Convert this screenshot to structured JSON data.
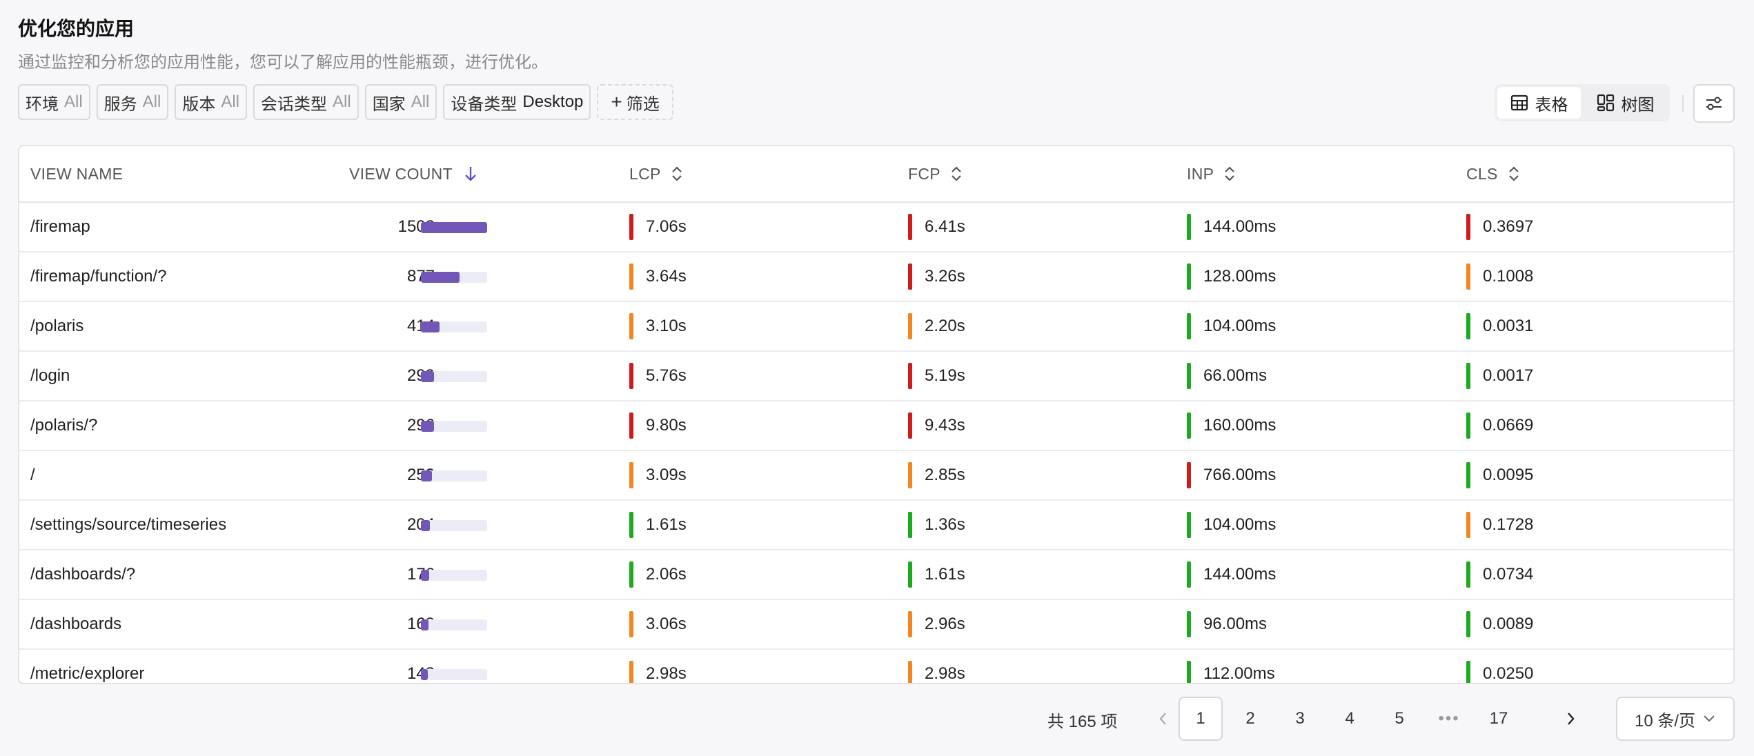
{
  "header": {
    "title": "优化您的应用",
    "subtitle": "通过监控和分析您的应用性能，您可以了解应用的性能瓶颈，进行优化。"
  },
  "filters": [
    {
      "label": "环境",
      "value": "All"
    },
    {
      "label": "服务",
      "value": "All"
    },
    {
      "label": "版本",
      "value": "All"
    },
    {
      "label": "会话类型",
      "value": "All"
    },
    {
      "label": "国家",
      "value": "All"
    },
    {
      "label": "设备类型",
      "value": "Desktop"
    }
  ],
  "add_filter_label": "筛选",
  "view_toggle": {
    "table_label": "表格",
    "tree_label": "树图",
    "active": "table"
  },
  "columns": {
    "view_name": "VIEW NAME",
    "view_count": "VIEW COUNT",
    "lcp": "LCP",
    "fcp": "FCP",
    "inp": "INP",
    "cls": "CLS"
  },
  "colors": {
    "good": "#1aab1f",
    "needs_improvement": "#f5861f",
    "poor": "#cf1b1b",
    "bar": "#7256b8"
  },
  "rows": [
    {
      "name": "/firemap",
      "count": "1502",
      "count_ratio": 1.0,
      "lcp": "7.06s",
      "lcp_s": "poor",
      "fcp": "6.41s",
      "fcp_s": "poor",
      "inp": "144.00ms",
      "inp_s": "good",
      "cls": "0.3697",
      "cls_s": "poor"
    },
    {
      "name": "/firemap/function/?",
      "count": "877",
      "count_ratio": 0.58,
      "lcp": "3.64s",
      "lcp_s": "needs_improvement",
      "fcp": "3.26s",
      "fcp_s": "poor",
      "inp": "128.00ms",
      "inp_s": "good",
      "cls": "0.1008",
      "cls_s": "needs_improvement"
    },
    {
      "name": "/polaris",
      "count": "414",
      "count_ratio": 0.28,
      "lcp": "3.10s",
      "lcp_s": "needs_improvement",
      "fcp": "2.20s",
      "fcp_s": "needs_improvement",
      "inp": "104.00ms",
      "inp_s": "good",
      "cls": "0.0031",
      "cls_s": "good"
    },
    {
      "name": "/login",
      "count": "299",
      "count_ratio": 0.2,
      "lcp": "5.76s",
      "lcp_s": "poor",
      "fcp": "5.19s",
      "fcp_s": "poor",
      "inp": "66.00ms",
      "inp_s": "good",
      "cls": "0.0017",
      "cls_s": "good"
    },
    {
      "name": "/polaris/?",
      "count": "296",
      "count_ratio": 0.2,
      "lcp": "9.80s",
      "lcp_s": "poor",
      "fcp": "9.43s",
      "fcp_s": "poor",
      "inp": "160.00ms",
      "inp_s": "good",
      "cls": "0.0669",
      "cls_s": "good"
    },
    {
      "name": "/",
      "count": "252",
      "count_ratio": 0.17,
      "lcp": "3.09s",
      "lcp_s": "needs_improvement",
      "fcp": "2.85s",
      "fcp_s": "needs_improvement",
      "inp": "766.00ms",
      "inp_s": "poor",
      "cls": "0.0095",
      "cls_s": "good"
    },
    {
      "name": "/settings/source/timeseries",
      "count": "204",
      "count_ratio": 0.14,
      "lcp": "1.61s",
      "lcp_s": "good",
      "fcp": "1.36s",
      "fcp_s": "good",
      "inp": "104.00ms",
      "inp_s": "good",
      "cls": "0.1728",
      "cls_s": "needs_improvement"
    },
    {
      "name": "/dashboards/?",
      "count": "176",
      "count_ratio": 0.12,
      "lcp": "2.06s",
      "lcp_s": "good",
      "fcp": "1.61s",
      "fcp_s": "good",
      "inp": "144.00ms",
      "inp_s": "good",
      "cls": "0.0734",
      "cls_s": "good"
    },
    {
      "name": "/dashboards",
      "count": "168",
      "count_ratio": 0.11,
      "lcp": "3.06s",
      "lcp_s": "needs_improvement",
      "fcp": "2.96s",
      "fcp_s": "needs_improvement",
      "inp": "96.00ms",
      "inp_s": "good",
      "cls": "0.0089",
      "cls_s": "good"
    },
    {
      "name": "/metric/explorer",
      "count": "142",
      "count_ratio": 0.1,
      "lcp": "2.98s",
      "lcp_s": "needs_improvement",
      "fcp": "2.98s",
      "fcp_s": "needs_improvement",
      "inp": "112.00ms",
      "inp_s": "good",
      "cls": "0.0250",
      "cls_s": "good"
    }
  ],
  "pagination": {
    "total_label": "共 165 项",
    "pages": [
      "1",
      "2",
      "3",
      "4",
      "5",
      "•••",
      "17"
    ],
    "current": "1",
    "page_size_label": "10 条/页"
  }
}
